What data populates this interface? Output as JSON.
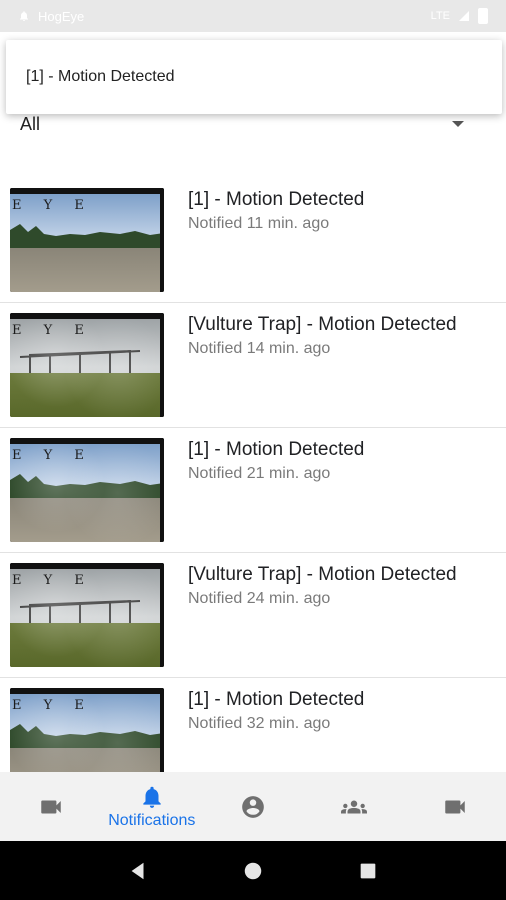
{
  "status_bar": {
    "app_name": "HogEye",
    "network": "LTE"
  },
  "filter": {
    "selected": "All"
  },
  "dropdown": {
    "options": [
      "[1] - Motion Detected"
    ]
  },
  "notifications": [
    {
      "title": "[1] - Motion Detected",
      "subtitle": "Notified 11 min. ago",
      "scene": "field"
    },
    {
      "title": "[Vulture Trap] - Motion Detected",
      "subtitle": "Notified 14 min. ago",
      "scene": "trap"
    },
    {
      "title": "[1] - Motion Detected",
      "subtitle": "Notified 21 min. ago",
      "scene": "field"
    },
    {
      "title": "[Vulture Trap] - Motion Detected",
      "subtitle": "Notified 24 min. ago",
      "scene": "trap"
    },
    {
      "title": "[1] - Motion Detected",
      "subtitle": "Notified 32 min. ago",
      "scene": "field"
    }
  ],
  "thumbnail_brand": "E Y E",
  "bottom_nav": {
    "active_label": "Notifications",
    "items": [
      "camera-icon",
      "bell-icon",
      "account-circle-icon",
      "group-icon",
      "camera-icon"
    ]
  },
  "colors": {
    "accent": "#1a73e8",
    "nav_icon": "#6f6f6f",
    "status_bar": "#e8e8e8"
  }
}
